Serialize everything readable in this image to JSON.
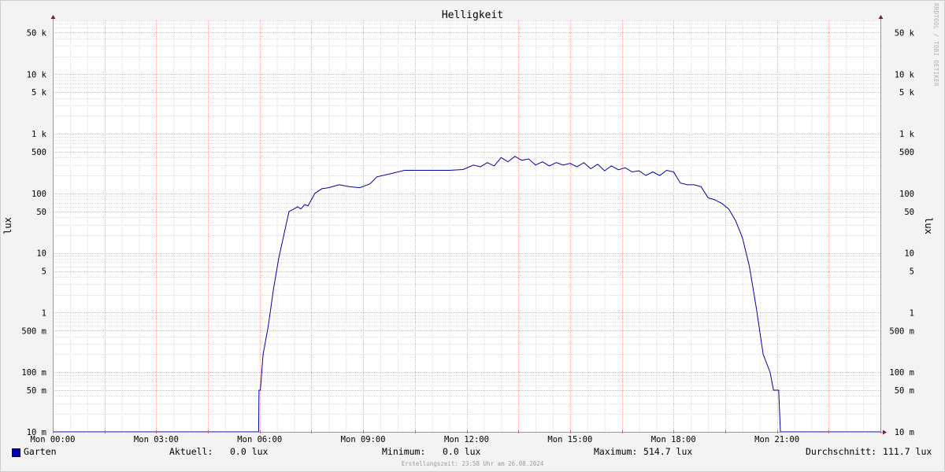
{
  "side_text": "RRDTOOL / TOBI OETIKER",
  "legend": {
    "series_name": "Garten",
    "color": "#0000aa",
    "current_label": "Aktuell:",
    "current_value": "0.0 lux",
    "min_label": "Minimum:",
    "min_value": "0.0 lux",
    "max_label": "Maximum:",
    "max_value": "514.7 lux",
    "avg_label": "Durchschnitt:",
    "avg_value": "111.7 lux"
  },
  "footer": "Erstellungszeit: 23:58 Uhr am 26.08.2024",
  "chart_data": {
    "type": "line",
    "title": "Helligkeit",
    "ylabel": "lux",
    "yscale": "log",
    "ylim": [
      0.01,
      80000
    ],
    "xlim_hours": [
      0,
      24
    ],
    "x_tick_labels": [
      "Mon 00:00",
      "Mon 03:00",
      "Mon 06:00",
      "Mon 09:00",
      "Mon 12:00",
      "Mon 15:00",
      "Mon 18:00",
      "Mon 21:00"
    ],
    "y_tick_labels": [
      {
        "value": 50000,
        "label": "50 k"
      },
      {
        "value": 10000,
        "label": "10 k"
      },
      {
        "value": 5000,
        "label": "5 k"
      },
      {
        "value": 1000,
        "label": "1 k"
      },
      {
        "value": 500,
        "label": "500"
      },
      {
        "value": 100,
        "label": "100"
      },
      {
        "value": 50,
        "label": "50"
      },
      {
        "value": 10,
        "label": "10"
      },
      {
        "value": 5,
        "label": "5"
      },
      {
        "value": 1,
        "label": "1"
      },
      {
        "value": 0.5,
        "label": "500 m"
      },
      {
        "value": 0.1,
        "label": "100 m"
      },
      {
        "value": 0.05,
        "label": "50 m"
      },
      {
        "value": 0.01,
        "label": "10 m"
      }
    ],
    "grid": true,
    "series": [
      {
        "name": "Garten",
        "color": "#0000aa",
        "x_hours": [
          0,
          5.97,
          5.98,
          6.02,
          6.1,
          6.25,
          6.4,
          6.55,
          6.7,
          6.85,
          7.0,
          7.1,
          7.2,
          7.3,
          7.4,
          7.6,
          7.8,
          8.0,
          8.3,
          8.6,
          8.9,
          9.2,
          9.4,
          9.8,
          10.2,
          10.6,
          11.0,
          11.5,
          11.9,
          12.2,
          12.4,
          12.6,
          12.8,
          13.0,
          13.2,
          13.4,
          13.6,
          13.8,
          14.0,
          14.2,
          14.4,
          14.6,
          14.8,
          15.0,
          15.2,
          15.4,
          15.6,
          15.8,
          16.0,
          16.2,
          16.4,
          16.6,
          16.8,
          17.0,
          17.2,
          17.4,
          17.6,
          17.8,
          18.0,
          18.2,
          18.4,
          18.6,
          18.8,
          19.0,
          19.2,
          19.4,
          19.6,
          19.8,
          20.0,
          20.2,
          20.4,
          20.6,
          20.8,
          20.9,
          21.05,
          21.1,
          21.18,
          24.0
        ],
        "values": [
          0.01,
          0.01,
          0.05,
          0.05,
          0.2,
          0.6,
          2.5,
          8,
          20,
          50,
          55,
          60,
          55,
          65,
          62,
          100,
          120,
          125,
          140,
          130,
          125,
          145,
          190,
          215,
          245,
          245,
          245,
          245,
          252,
          300,
          280,
          330,
          290,
          400,
          340,
          420,
          360,
          380,
          300,
          340,
          290,
          330,
          300,
          320,
          280,
          330,
          260,
          310,
          240,
          290,
          250,
          270,
          230,
          240,
          200,
          230,
          200,
          245,
          230,
          150,
          140,
          140,
          130,
          85,
          78,
          68,
          55,
          35,
          18,
          6,
          1.2,
          0.2,
          0.1,
          0.05,
          0.05,
          0.01,
          0.01,
          0.01
        ]
      }
    ]
  }
}
